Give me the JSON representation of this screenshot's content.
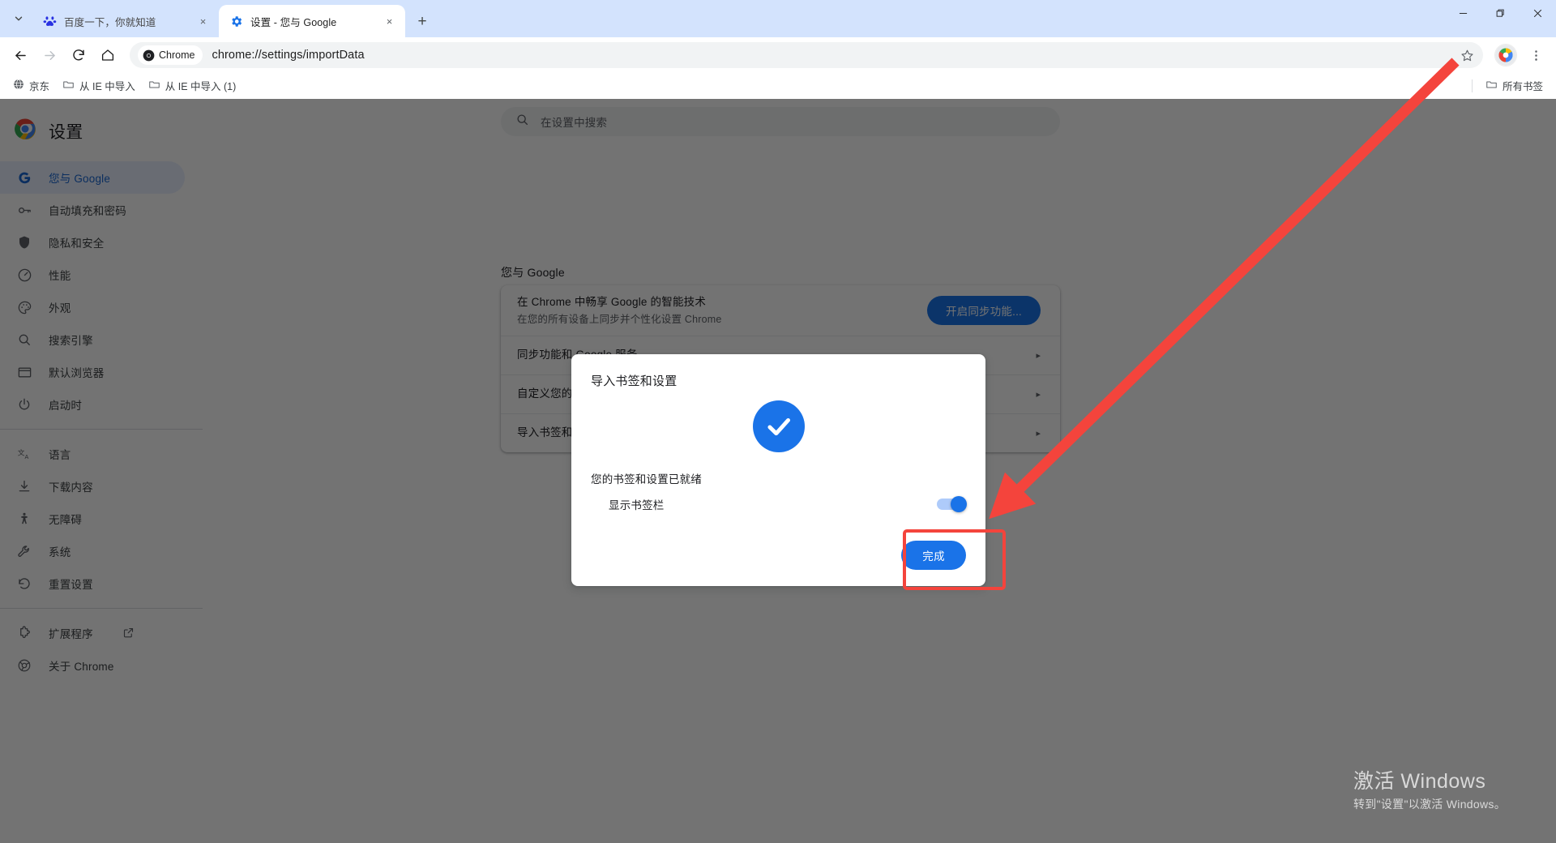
{
  "window": {
    "controls": {
      "minimize": "minimize-icon",
      "maximize": "restore-icon",
      "close": "close-icon"
    }
  },
  "tabstrip": {
    "tab_search_label": "tab-search-icon",
    "new_tab_label": "+",
    "tabs": [
      {
        "title": "百度一下，你就知道",
        "favicon": "baidu-favicon",
        "active": false,
        "close": "×"
      },
      {
        "title": "设置 - 您与 Google",
        "favicon": "settings-gear-favicon",
        "active": true,
        "close": "×"
      }
    ]
  },
  "toolbar": {
    "back": "back-arrow-icon",
    "forward": "forward-arrow-icon",
    "reload": "reload-icon",
    "home": "home-icon",
    "chip_label": "Chrome",
    "url": "chrome://settings/importData",
    "bookmark_star": "star-icon",
    "profile": "profile-avatar",
    "menu": "three-dot-menu-icon"
  },
  "bookmark_bar": {
    "items": [
      {
        "label": "京东",
        "icon": "globe-favicon"
      },
      {
        "label": "从 IE 中导入",
        "icon": "folder-icon"
      },
      {
        "label": "从 IE 中导入 (1)",
        "icon": "folder-icon"
      }
    ],
    "all_bookmarks": {
      "label": "所有书签",
      "icon": "folder-icon"
    }
  },
  "settings": {
    "brand_title": "设置",
    "search": {
      "placeholder": "在设置中搜索",
      "icon": "search-icon"
    },
    "sidebar_items": [
      {
        "label": "您与 Google",
        "icon": "google-g-icon",
        "selected": true
      },
      {
        "label": "自动填充和密码",
        "icon": "key-icon",
        "selected": false
      },
      {
        "label": "隐私和安全",
        "icon": "shield-icon",
        "selected": false
      },
      {
        "label": "性能",
        "icon": "speedometer-icon",
        "selected": false
      },
      {
        "label": "外观",
        "icon": "palette-icon",
        "selected": false
      },
      {
        "label": "搜索引擎",
        "icon": "search-icon",
        "selected": false
      },
      {
        "label": "默认浏览器",
        "icon": "browser-window-icon",
        "selected": false
      },
      {
        "label": "启动时",
        "icon": "power-icon",
        "selected": false
      }
    ],
    "sidebar_items_group2": [
      {
        "label": "语言",
        "icon": "translate-icon",
        "selected": false
      },
      {
        "label": "下载内容",
        "icon": "download-icon",
        "selected": false
      },
      {
        "label": "无障碍",
        "icon": "accessibility-icon",
        "selected": false
      },
      {
        "label": "系统",
        "icon": "wrench-icon",
        "selected": false
      },
      {
        "label": "重置设置",
        "icon": "restore-icon",
        "selected": false
      }
    ],
    "sidebar_items_group3": [
      {
        "label": "扩展程序",
        "icon": "extension-puzzle-icon",
        "external": true
      },
      {
        "label": "关于 Chrome",
        "icon": "chrome-logo-icon",
        "external": false
      }
    ],
    "section_title": "您与 Google",
    "rows": [
      {
        "title": "在 Chrome 中畅享 Google 的智能技术",
        "subtitle": "在您的所有设备上同步并个性化设置 Chrome",
        "action_label": "开启同步功能...",
        "type": "button"
      },
      {
        "title": "同步功能和 Google 服务",
        "subtitle": "",
        "type": "chevron"
      },
      {
        "title": "自定义您的 Chrome 个人资料",
        "subtitle": "",
        "type": "chevron"
      },
      {
        "title": "导入书签和设置",
        "subtitle": "",
        "type": "chevron"
      }
    ],
    "chevron_glyph": "▸"
  },
  "dialog": {
    "title": "导入书签和设置",
    "success_icon": "check-circle-icon",
    "ready_text": "您的书签和设置已就绪",
    "toggle_label": "显示书签栏",
    "toggle_on": true,
    "done_label": "完成"
  },
  "annotations": {
    "arrow_color": "#f4443c",
    "highlight_color": "#f4443c"
  },
  "watermark": {
    "line1": "激活 Windows",
    "line2": "转到\"设置\"以激活 Windows。"
  },
  "colors": {
    "accent_blue": "#1a73e8",
    "tabstrip_blue": "#d3e3fd",
    "selected_nav_bg": "#e8f0fe",
    "selected_nav_fg": "#1967d2",
    "annotation_red": "#f4443c"
  }
}
